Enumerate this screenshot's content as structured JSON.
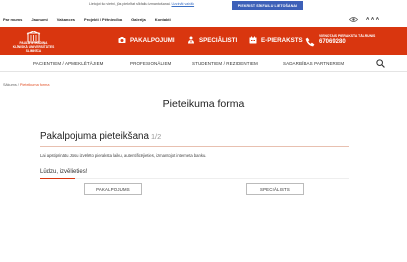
{
  "cookie_bar": {
    "text": "Lietojot šo vietni, jūs piekrītat sīkfailu izmantošanai.",
    "link": "Uzzināt vairāk",
    "button": "PIEKRIST SĪKFAILU LIETOŠANAI"
  },
  "top_nav": {
    "items": [
      {
        "label": "Par mums"
      },
      {
        "label": "Jaunumi"
      },
      {
        "label": "Vakances"
      },
      {
        "label": "Projekti / Pētniecība"
      },
      {
        "label": "Galerija"
      },
      {
        "label": "Kontakti"
      }
    ],
    "font_size_label": "A A A"
  },
  "header": {
    "logo_text_1": "PAULA STRADIŅA",
    "logo_text_2": "KLĪNISKĀ UNIVERSITĀTES SLIMNĪCA",
    "links": [
      {
        "label": "PAKALPOJUMI",
        "icon": "camera-icon"
      },
      {
        "label": "SPECIĀLISTI",
        "icon": "doctor-icon"
      },
      {
        "label": "E-PIERAKSTS",
        "icon": "calendar-icon"
      }
    ],
    "phone_label": "VIENOTAIS PIERAKSTA TĀLRUNIS",
    "phone_number": "67069280",
    "brand_color": "#d9360f"
  },
  "secondary_nav": {
    "items": [
      {
        "label": "PACIENTIEM / APMEKLĒTĀJIEM"
      },
      {
        "label": "PROFESIONĀLIEM"
      },
      {
        "label": "STUDENTIEM / REZIDENTIEM"
      },
      {
        "label": "SADARBĪBAS PARTNERIEM"
      }
    ]
  },
  "breadcrumb": {
    "home": "Sākums",
    "separator": "/",
    "current": "Pieteikuma forma"
  },
  "page": {
    "title": "Pieteikuma forma",
    "card_title": "Pakalpojuma pieteikšana",
    "step": "1/2",
    "description": "Lai apstiprinātu Jūsu izvēlēto pieraksta laiku, autentificējieties, izmantojot interneta banku.",
    "choose_label": "Lūdzu, izvēlieties!",
    "options": [
      {
        "label": "PAKALPOJUMS"
      },
      {
        "label": "SPECIĀLISTS"
      }
    ]
  }
}
